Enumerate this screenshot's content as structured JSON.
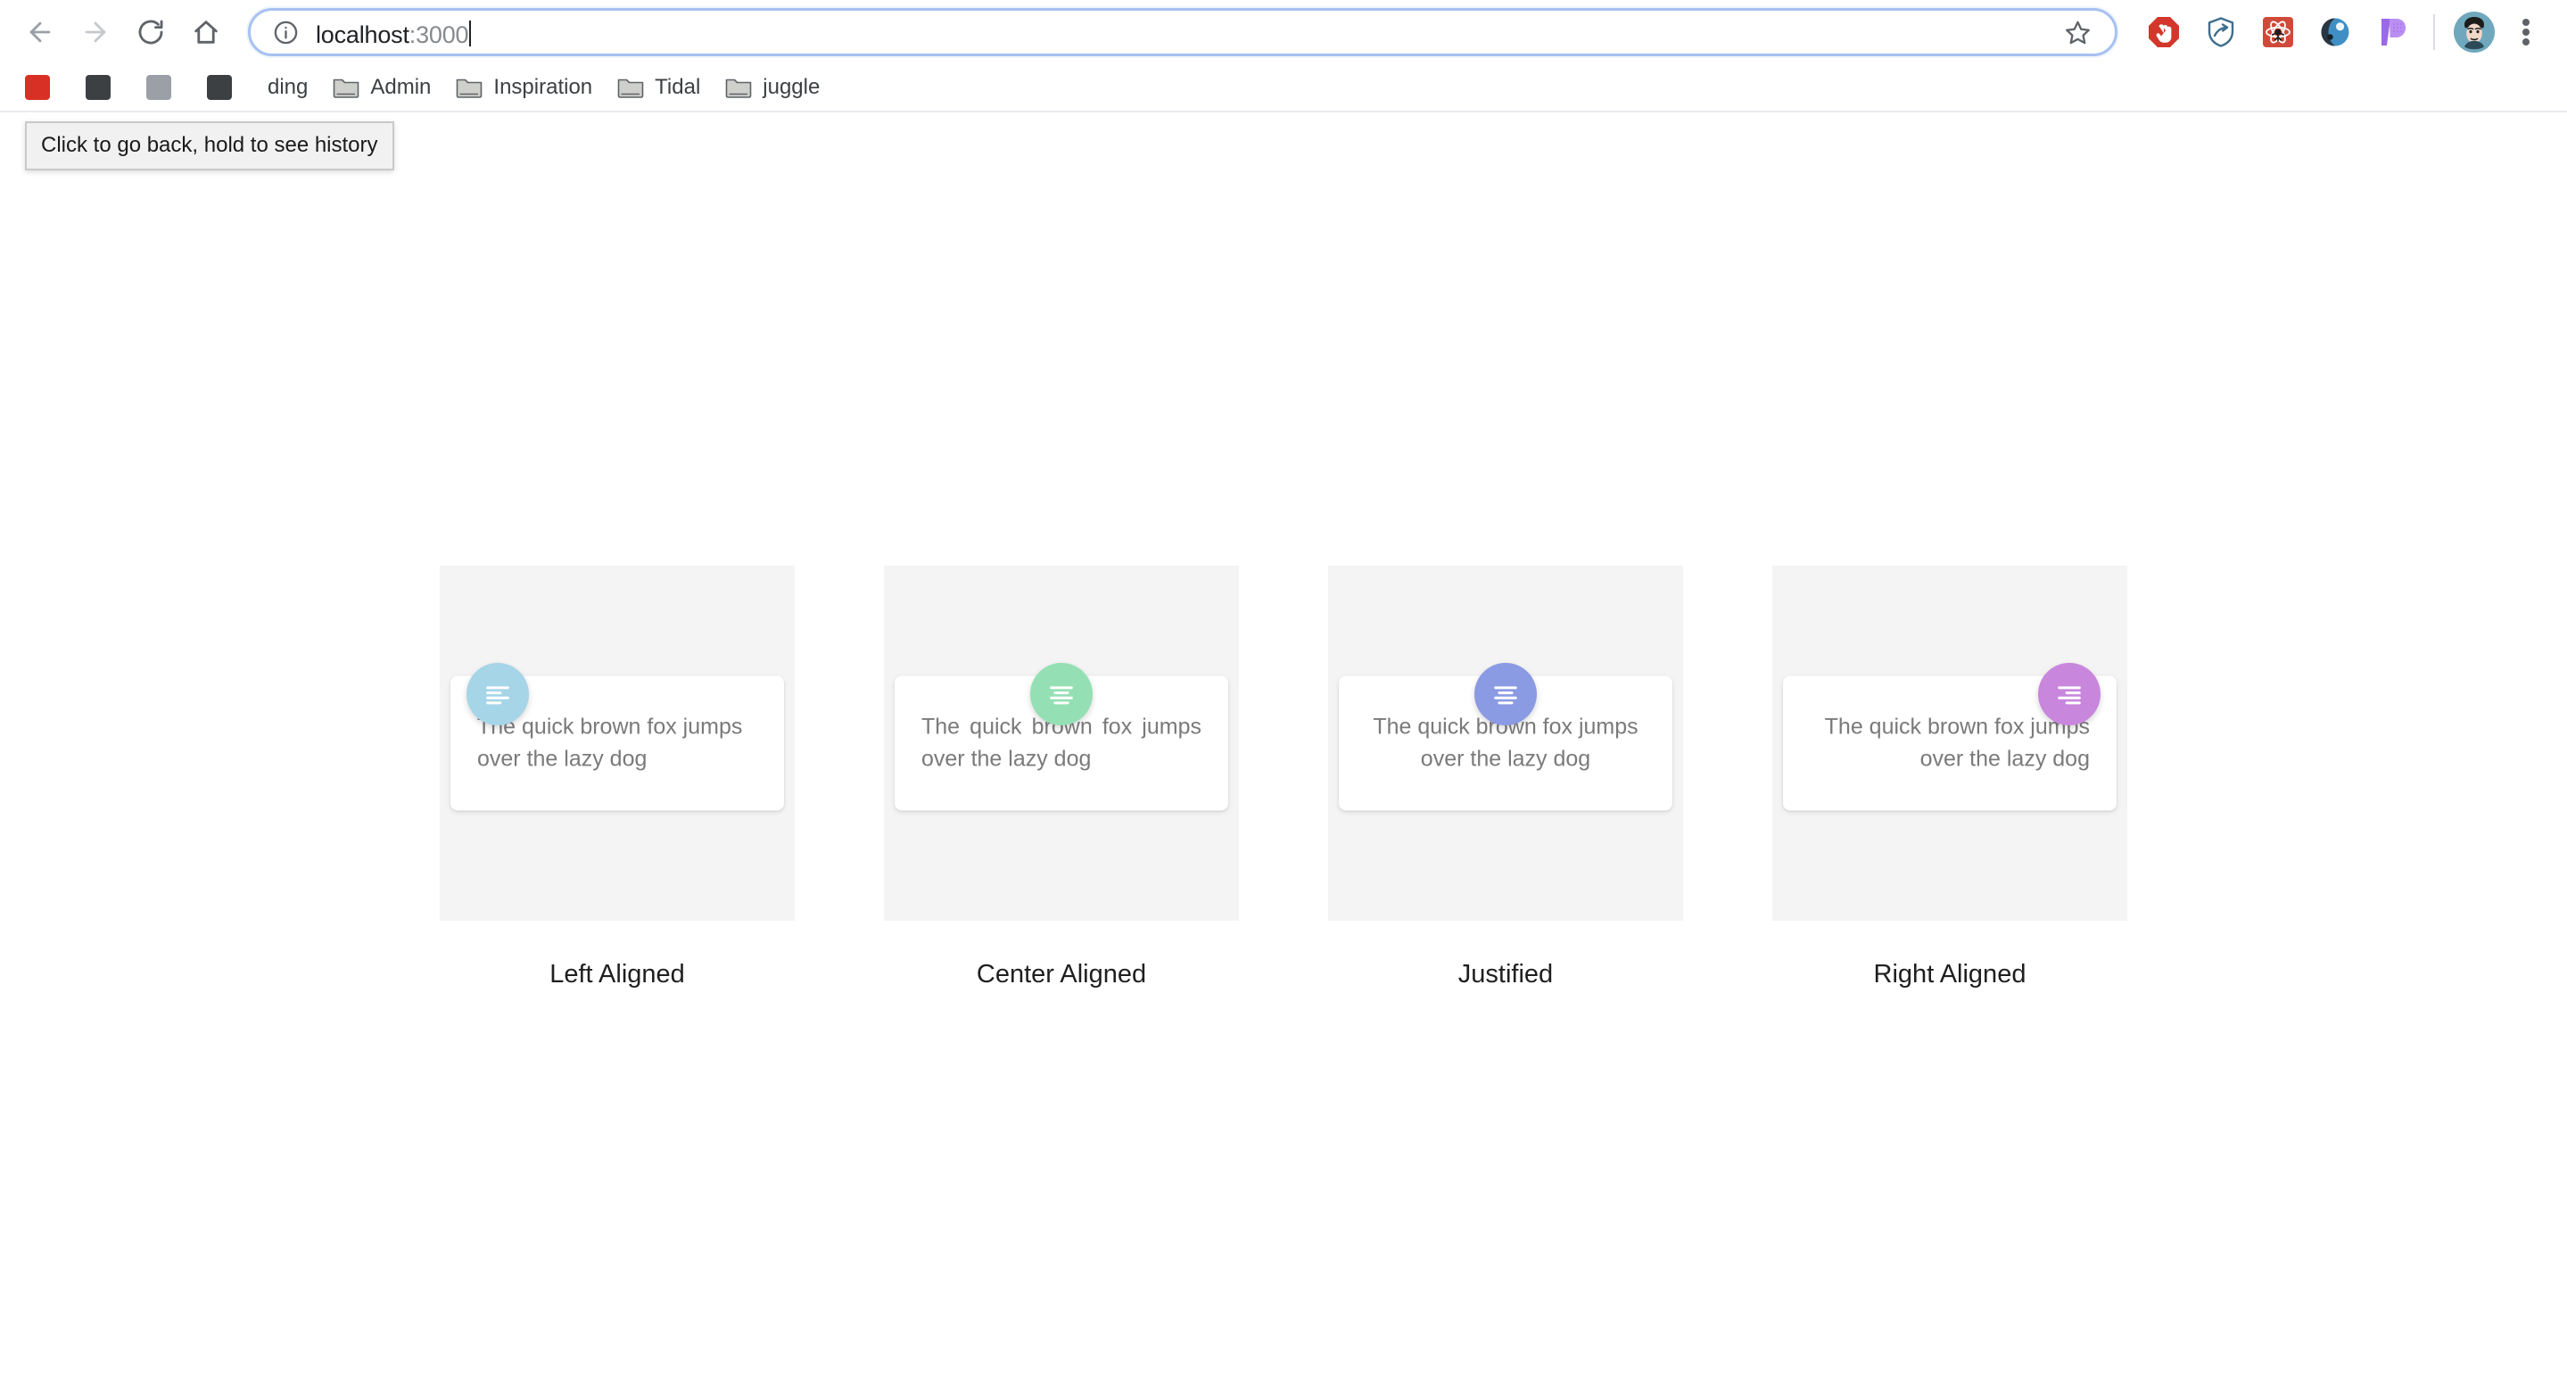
{
  "browser": {
    "nav": {
      "back_label": "Back",
      "forward_label": "Forward",
      "reload_label": "Reload",
      "home_label": "Home"
    },
    "omnibox": {
      "url_host": "localhost",
      "url_port": ":3000",
      "full_url": "localhost:3000",
      "info_icon": "info-circle-icon",
      "star_icon": "bookmark-star-icon",
      "focus_ring_color": "#a7c1f0"
    },
    "tooltip": {
      "text": "Click to go back, hold to see history"
    },
    "extensions": [
      {
        "name": "adblock-extension-icon",
        "color": "#d3372b"
      },
      {
        "name": "shield-privacy-extension-icon",
        "color": "#3d6e8f"
      },
      {
        "name": "react-devtools-extension-icon",
        "color": "#cf4a38"
      },
      {
        "name": "blue-orb-extension-icon",
        "color": "#3f8fc4"
      },
      {
        "name": "purple-p-extension-icon",
        "color": "#b07ae8"
      }
    ],
    "profile": {
      "name": "profile-avatar",
      "color": "#6fa8bd"
    },
    "menu": {
      "name": "three-dot-menu"
    },
    "bookmarks": [
      {
        "label": "",
        "icon": "favicon-red",
        "truncated": true
      },
      {
        "label": "",
        "icon": "favicon-dark",
        "truncated": true
      },
      {
        "label": "",
        "icon": "favicon-grey",
        "truncated": true
      },
      {
        "label": "",
        "icon": "favicon-dark",
        "truncated": true
      },
      {
        "label": "ding",
        "icon": "favicon-hidden",
        "truncated": true
      },
      {
        "label": "Admin",
        "icon": "folder-icon",
        "truncated": false
      },
      {
        "label": "Inspiration",
        "icon": "folder-icon",
        "truncated": false
      },
      {
        "label": "Tidal",
        "icon": "folder-icon",
        "truncated": false
      },
      {
        "label": "juggle",
        "icon": "folder-icon",
        "truncated": false
      }
    ]
  },
  "page": {
    "background": "#ffffff",
    "tile_background": "#f4f4f4",
    "sample_text": "The quick brown fox jumps over the lazy dog",
    "cards": [
      {
        "label": "Left Aligned",
        "alignment": "left",
        "fab_position": "left",
        "fab_color": "#a6d5e8",
        "icon": "format-align-left-icon"
      },
      {
        "label": "Center Aligned",
        "alignment": "justify",
        "fab_position": "center",
        "fab_color": "#94e0b4",
        "icon": "format-align-center-icon"
      },
      {
        "label": "Justified",
        "alignment": "center",
        "fab_position": "center",
        "fab_color": "#8a9ae3",
        "icon": "format-align-justify-icon"
      },
      {
        "label": "Right Aligned",
        "alignment": "right",
        "fab_position": "right",
        "fab_color": "#c986dd",
        "icon": "format-align-right-icon"
      }
    ]
  }
}
